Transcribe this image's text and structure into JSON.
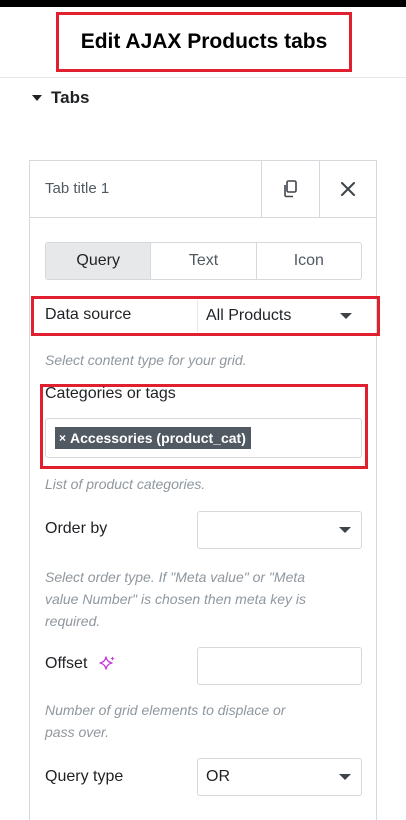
{
  "header": {
    "title": "Edit AJAX Products tabs"
  },
  "section": {
    "label": "Tabs"
  },
  "repeater_item": {
    "title": "Tab title 1",
    "tabs": [
      {
        "label": "Query",
        "active": true
      },
      {
        "label": "Text",
        "active": false
      },
      {
        "label": "Icon",
        "active": false
      }
    ]
  },
  "fields": {
    "data_source": {
      "label": "Data source",
      "value": "All Products",
      "hint": "Select content type for your grid."
    },
    "categories": {
      "label": "Categories or tags",
      "tags": [
        "Accessories (product_cat)"
      ],
      "hint": "List of product categories."
    },
    "order_by": {
      "label": "Order by",
      "value": "",
      "hint_1": "Select order type. If \"Meta value\" or \"Meta",
      "hint_2": "value Number\" is chosen then meta key is",
      "hint_3": "required."
    },
    "offset": {
      "label": "Offset",
      "value": "",
      "hint_1": "Number of grid elements to displace or",
      "hint_2": "pass over."
    },
    "query_type": {
      "label": "Query type",
      "value": "OR"
    }
  },
  "colors": {
    "highlight": "#e0202f",
    "ai_accent": "#c73bd8",
    "tab_active_bg": "#e6e8ea",
    "tag_bg": "#515962"
  }
}
